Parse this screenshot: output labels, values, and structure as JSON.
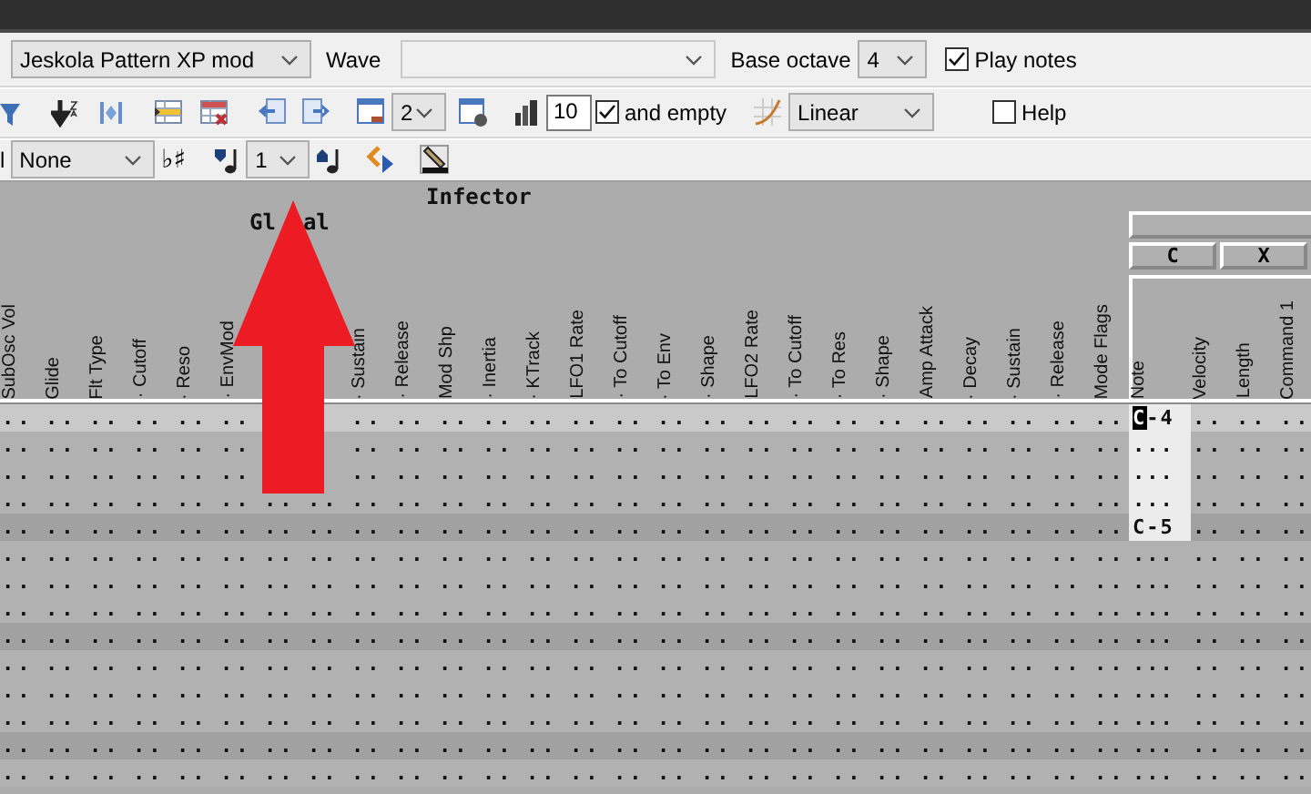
{
  "toolbar": {
    "machine": {
      "value": "Jeskola Pattern XP mod"
    },
    "wave_label": "Wave",
    "base_octave_label": "Base octave",
    "base_octave": {
      "value": "4"
    },
    "play_notes": {
      "label": "Play notes",
      "checked": true
    },
    "pages": {
      "value": "2"
    },
    "step": {
      "value": "10"
    },
    "and_empty": {
      "label": "and empty",
      "checked": true
    },
    "interpolation": {
      "value": "Linear"
    },
    "help": {
      "label": "Help",
      "checked": false
    },
    "cut_label": "l",
    "chord": {
      "value": "None"
    },
    "accidental": "♭♯",
    "transpose": {
      "value": "1"
    }
  },
  "pattern": {
    "machine_name": "Infector",
    "group_label_parts": [
      "Gl",
      "al"
    ],
    "columns": [
      {
        "label": "SubOsc Vol"
      },
      {
        "label": "Glide"
      },
      {
        "label": "Flt Type"
      },
      {
        "label": "· Cutoff"
      },
      {
        "label": "· Reso"
      },
      {
        "label": "· EnvMod"
      },
      {},
      {},
      {
        "label": "· Sustain"
      },
      {
        "label": "· Release"
      },
      {
        "label": "Mod Shp"
      },
      {
        "label": "· Inertia"
      },
      {
        "label": "· KTrack"
      },
      {
        "label": "LFO1 Rate"
      },
      {
        "label": "· To Cutoff"
      },
      {
        "label": "· To Env"
      },
      {
        "label": "· Shape"
      },
      {
        "label": "LFO2 Rate"
      },
      {
        "label": "· To Cutoff"
      },
      {
        "label": "· To Res"
      },
      {
        "label": "· Shape"
      },
      {
        "label": "Amp Attack"
      },
      {
        "label": "· Decay"
      },
      {
        "label": "· Sustain"
      },
      {
        "label": "· Release"
      },
      {
        "label": "Mode Flags"
      }
    ],
    "track": {
      "buttons": [
        "C",
        "X"
      ],
      "columns": [
        "Note",
        "Velocity",
        "Length",
        "Command 1"
      ]
    },
    "rows": [
      {
        "kind": "cursor",
        "params": [
          "..",
          "..",
          "..",
          "..",
          "..",
          ".."
        ],
        "params_after_arrow": [
          "..",
          "..",
          "..",
          "..",
          "..",
          "..",
          "..",
          "..",
          "..",
          "..",
          "..",
          "..",
          "..",
          "..",
          "..",
          "..",
          "..",
          ".."
        ],
        "note": "C-4",
        "note_selected": true,
        "cursor": true,
        "track": [
          "..",
          "..",
          ".."
        ]
      },
      {
        "kind": "plain",
        "params": [
          "..",
          "..",
          "..",
          "..",
          "..",
          ".."
        ],
        "params_after_arrow": [
          "..",
          "..",
          "..",
          "..",
          "..",
          "..",
          "..",
          "..",
          "..",
          "..",
          "..",
          "..",
          "..",
          "..",
          "..",
          "..",
          "..",
          ".."
        ],
        "note": "...",
        "note_selected": true,
        "cursor": false,
        "track": [
          "..",
          "..",
          ".."
        ]
      },
      {
        "kind": "plain",
        "params": [
          "..",
          "..",
          "..",
          "..",
          "..",
          ".."
        ],
        "params_after_arrow": [
          "..",
          "..",
          "..",
          "..",
          "..",
          "..",
          "..",
          "..",
          "..",
          "..",
          "..",
          "..",
          "..",
          "..",
          "..",
          "..",
          "..",
          ".."
        ],
        "note": "...",
        "note_selected": true,
        "cursor": false,
        "track": [
          "..",
          "..",
          ".."
        ]
      },
      {
        "kind": "plain",
        "params": [
          "..",
          "..",
          "..",
          "..",
          "..",
          "..",
          "..",
          "..",
          "..",
          "..",
          "..",
          "..",
          "..",
          "..",
          "..",
          "..",
          "..",
          "..",
          "..",
          "..",
          "..",
          "..",
          "..",
          "..",
          "..",
          ".."
        ],
        "note": "...",
        "note_selected": true,
        "cursor": false,
        "track": [
          "..",
          "..",
          ".."
        ]
      },
      {
        "kind": "beat",
        "params": [
          "..",
          "..",
          "..",
          "..",
          "..",
          "..",
          "..",
          "..",
          "..",
          "..",
          "..",
          "..",
          "..",
          "..",
          "..",
          "..",
          "..",
          "..",
          "..",
          "..",
          "..",
          "..",
          "..",
          "..",
          "..",
          ".."
        ],
        "note": "C-5",
        "note_selected": true,
        "cursor": false,
        "track": [
          "..",
          "..",
          ".."
        ]
      },
      {
        "kind": "plain",
        "params": [
          "..",
          "..",
          "..",
          "..",
          "..",
          "..",
          "..",
          "..",
          "..",
          "..",
          "..",
          "..",
          "..",
          "..",
          "..",
          "..",
          "..",
          "..",
          "..",
          "..",
          "..",
          "..",
          "..",
          "..",
          "..",
          ".."
        ],
        "note": "...",
        "note_selected": false,
        "cursor": false,
        "track": [
          "..",
          "..",
          ".."
        ]
      },
      {
        "kind": "plain",
        "params": [
          "..",
          "..",
          "..",
          "..",
          "..",
          "..",
          "..",
          "..",
          "..",
          "..",
          "..",
          "..",
          "..",
          "..",
          "..",
          "..",
          "..",
          "..",
          "..",
          "..",
          "..",
          "..",
          "..",
          "..",
          "..",
          ".."
        ],
        "note": "...",
        "note_selected": false,
        "cursor": false,
        "track": [
          "..",
          "..",
          ".."
        ]
      },
      {
        "kind": "plain",
        "params": [
          "..",
          "..",
          "..",
          "..",
          "..",
          "..",
          "..",
          "..",
          "..",
          "..",
          "..",
          "..",
          "..",
          "..",
          "..",
          "..",
          "..",
          "..",
          "..",
          "..",
          "..",
          "..",
          "..",
          "..",
          "..",
          ".."
        ],
        "note": "...",
        "note_selected": false,
        "cursor": false,
        "track": [
          "..",
          "..",
          ".."
        ]
      },
      {
        "kind": "beat",
        "params": [
          "..",
          "..",
          "..",
          "..",
          "..",
          "..",
          "..",
          "..",
          "..",
          "..",
          "..",
          "..",
          "..",
          "..",
          "..",
          "..",
          "..",
          "..",
          "..",
          "..",
          "..",
          "..",
          "..",
          "..",
          "..",
          ".."
        ],
        "note": "...",
        "note_selected": false,
        "cursor": false,
        "track": [
          "..",
          "..",
          ".."
        ]
      },
      {
        "kind": "plain",
        "params": [
          "..",
          "..",
          "..",
          "..",
          "..",
          "..",
          "..",
          "..",
          "..",
          "..",
          "..",
          "..",
          "..",
          "..",
          "..",
          "..",
          "..",
          "..",
          "..",
          "..",
          "..",
          "..",
          "..",
          "..",
          "..",
          ".."
        ],
        "note": "...",
        "note_selected": false,
        "cursor": false,
        "track": [
          "..",
          "..",
          ".."
        ]
      },
      {
        "kind": "plain",
        "params": [
          "..",
          "..",
          "..",
          "..",
          "..",
          "..",
          "..",
          "..",
          "..",
          "..",
          "..",
          "..",
          "..",
          "..",
          "..",
          "..",
          "..",
          "..",
          "..",
          "..",
          "..",
          "..",
          "..",
          "..",
          "..",
          ".."
        ],
        "note": "...",
        "note_selected": false,
        "cursor": false,
        "track": [
          "..",
          "..",
          ".."
        ]
      },
      {
        "kind": "plain",
        "params": [
          "..",
          "..",
          "..",
          "..",
          "..",
          "..",
          "..",
          "..",
          "..",
          "..",
          "..",
          "..",
          "..",
          "..",
          "..",
          "..",
          "..",
          "..",
          "..",
          "..",
          "..",
          "..",
          "..",
          "..",
          "..",
          ".."
        ],
        "note": "...",
        "note_selected": false,
        "cursor": false,
        "track": [
          "..",
          "..",
          ".."
        ]
      },
      {
        "kind": "beat",
        "params": [
          "..",
          "..",
          "..",
          "..",
          "..",
          "..",
          "..",
          "..",
          "..",
          "..",
          "..",
          "..",
          "..",
          "..",
          "..",
          "..",
          "..",
          "..",
          "..",
          "..",
          "..",
          "..",
          "..",
          "..",
          "..",
          ".."
        ],
        "note": "...",
        "note_selected": false,
        "cursor": false,
        "track": [
          "..",
          "..",
          ".."
        ]
      },
      {
        "kind": "plain",
        "params": [
          "..",
          "..",
          "..",
          "..",
          "..",
          "..",
          "..",
          "..",
          "..",
          "..",
          "..",
          "..",
          "..",
          "..",
          "..",
          "..",
          "..",
          "..",
          "..",
          "..",
          "..",
          "..",
          "..",
          "..",
          "..",
          ".."
        ],
        "note": "...",
        "note_selected": false,
        "cursor": false,
        "track": [
          "..",
          "..",
          ".."
        ]
      }
    ]
  }
}
